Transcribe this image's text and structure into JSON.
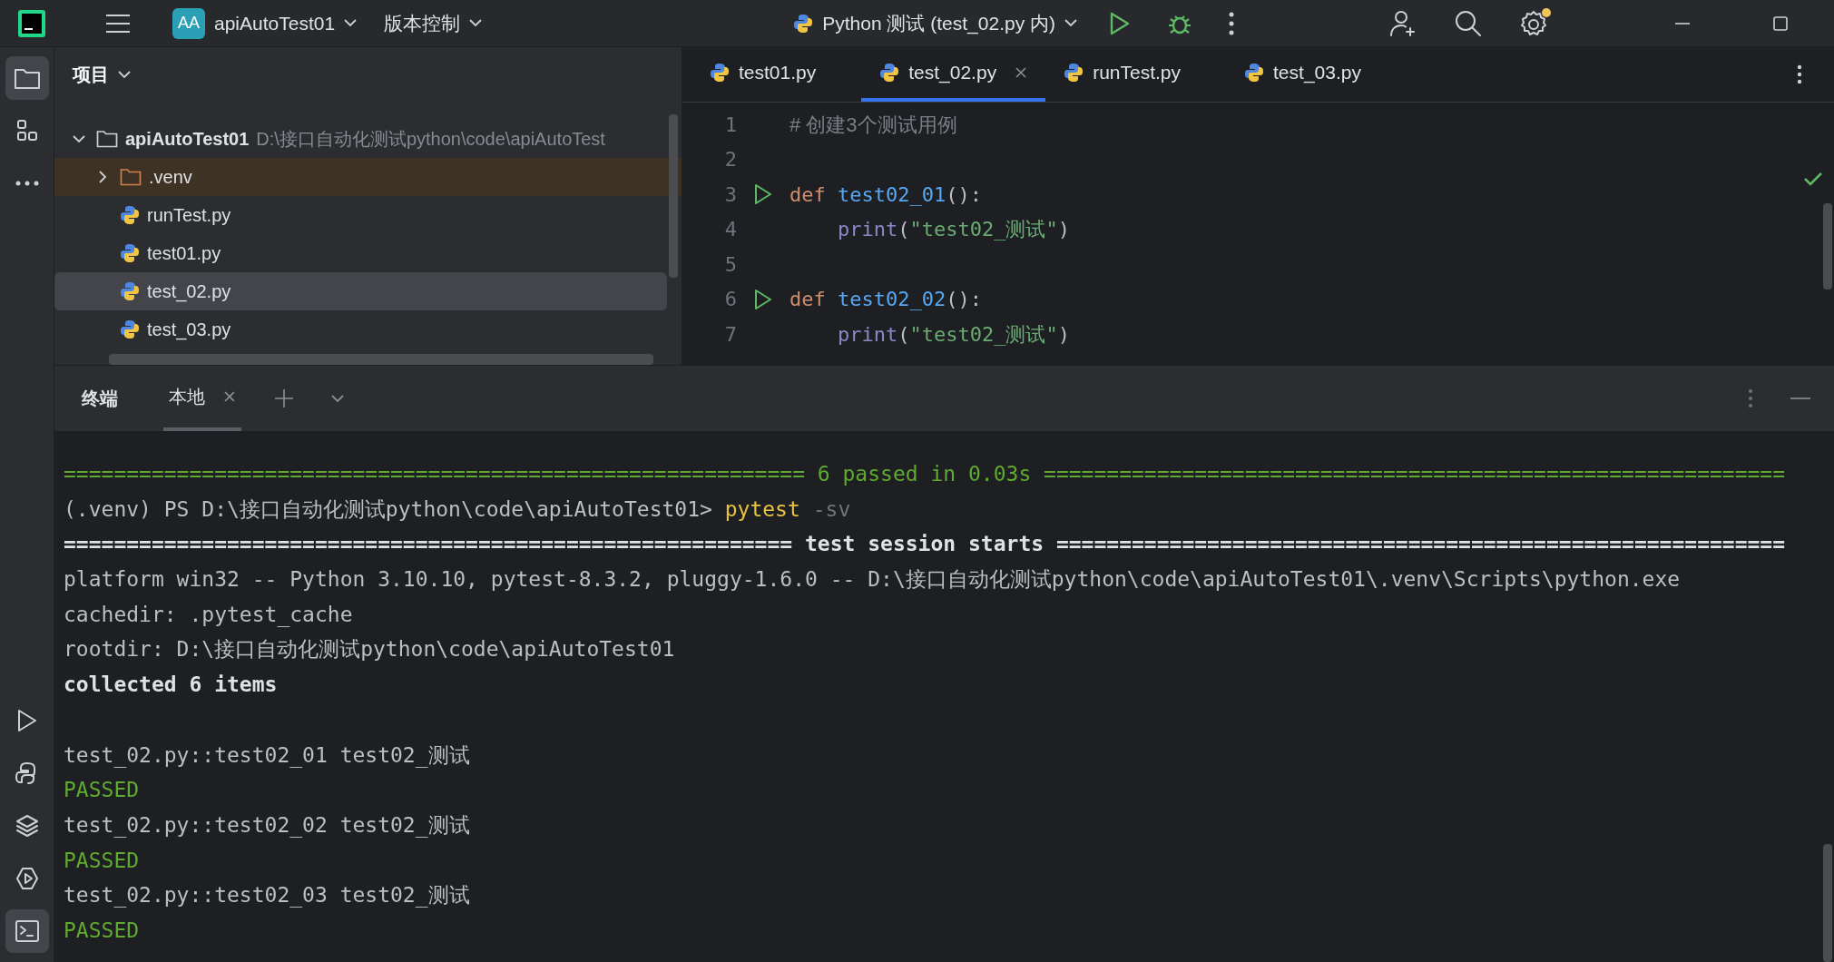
{
  "title_bar": {
    "project_badge": "AA",
    "project": "apiAutoTest01",
    "vcs": "版本控制",
    "run_config": "Python 测试 (test_02.py 内)",
    "settings_notice": true
  },
  "tool_strip": {
    "top": [
      {
        "selected": true
      },
      {
        "selected": false
      },
      {
        "selected": false
      }
    ],
    "bottom": [
      {
        "selected": false
      },
      {
        "selected": false
      },
      {
        "selected": false
      },
      {
        "selected": false
      },
      {
        "selected": true
      }
    ]
  },
  "project_panel": {
    "title": "项目",
    "tree": [
      {
        "kind": "folder",
        "name": "apiAutoTest01",
        "path": "D:\\接口自动化测试python\\code\\apiAutoTest",
        "expanded": true,
        "excluded": false,
        "selected": false,
        "children": [
          {
            "kind": "folder",
            "name": ".venv",
            "expanded": false,
            "excluded": true,
            "selected": false
          },
          {
            "kind": "python",
            "name": "runTest.py",
            "excluded": false,
            "selected": false
          },
          {
            "kind": "python",
            "name": "test01.py",
            "excluded": false,
            "selected": false
          },
          {
            "kind": "python",
            "name": "test_02.py",
            "excluded": false,
            "selected": true
          },
          {
            "kind": "python",
            "name": "test_03.py",
            "excluded": false,
            "selected": false
          }
        ]
      }
    ]
  },
  "editor": {
    "tabs": [
      {
        "label": "test01.py",
        "selected": false
      },
      {
        "label": "test_02.py",
        "selected": true
      },
      {
        "label": "runTest.py",
        "selected": false
      },
      {
        "label": "test_03.py",
        "selected": false
      }
    ],
    "lines": [
      {
        "number": "1",
        "run_marker": false,
        "indent": false,
        "tokens": [
          {
            "kind": "comment",
            "text": "# 创建3个测试用例"
          }
        ]
      },
      {
        "number": "2",
        "run_marker": false
      },
      {
        "number": "3",
        "run_marker": true,
        "indent": false,
        "tokens": [
          {
            "kind": "keyword",
            "text": "def"
          },
          {
            "kind": "function",
            "text": "test02_01"
          },
          {
            "kind": "punct",
            "text": "():"
          }
        ]
      },
      {
        "number": "4",
        "run_marker": false,
        "indent": true,
        "tokens": [
          {
            "kind": "builtin",
            "text": "print"
          },
          {
            "kind": "punct",
            "text": "("
          },
          {
            "kind": "string",
            "text": "\"test02_测试\""
          },
          {
            "kind": "punct",
            "text": ")"
          }
        ]
      },
      {
        "number": "5",
        "run_marker": false
      },
      {
        "number": "6",
        "run_marker": true,
        "indent": false,
        "tokens": [
          {
            "kind": "keyword",
            "text": "def"
          },
          {
            "kind": "function",
            "text": "test02_02"
          },
          {
            "kind": "punct",
            "text": "():"
          }
        ]
      },
      {
        "number": "7",
        "run_marker": false,
        "indent": true,
        "tokens": [
          {
            "kind": "builtin",
            "text": "print"
          },
          {
            "kind": "punct",
            "text": "("
          },
          {
            "kind": "string",
            "text": "\"test02_测试\""
          },
          {
            "kind": "punct",
            "text": ")"
          }
        ]
      }
    ]
  },
  "terminal": {
    "title": "终端",
    "tabs": [
      {
        "label": "本地",
        "selected": true
      }
    ],
    "lines": [
      {
        "kind": "summary",
        "text": "=========================================================== 6 passed in 0.03s ==========================================================="
      },
      {
        "kind": "prompt",
        "text": "(.venv) PS D:\\接口自动化测试python\\code\\apiAutoTest01>",
        "command": "pytest",
        "args": "-sv"
      },
      {
        "kind": "header",
        "text": "========================================================== test session starts =========================================================="
      },
      {
        "kind": "plain",
        "text": "platform win32 -- Python 3.10.10, pytest-8.3.2, pluggy-1.6.0 -- D:\\接口自动化测试python\\code\\apiAutoTest01\\.venv\\Scripts\\python.exe"
      },
      {
        "kind": "plain",
        "text": "cachedir: .pytest_cache"
      },
      {
        "kind": "plain",
        "text": "rootdir: D:\\接口自动化测试python\\code\\apiAutoTest01"
      },
      {
        "kind": "bold",
        "text": "collected 6 items"
      },
      {
        "kind": "blank"
      },
      {
        "kind": "plain",
        "text": "test_02.py::test02_01 test02_测试"
      },
      {
        "kind": "passed",
        "text": "PASSED"
      },
      {
        "kind": "plain",
        "text": "test_02.py::test02_02 test02_测试"
      },
      {
        "kind": "passed",
        "text": "PASSED"
      },
      {
        "kind": "plain",
        "text": "test_02.py::test02_03 test02_测试"
      },
      {
        "kind": "passed",
        "text": "PASSED"
      }
    ]
  }
}
